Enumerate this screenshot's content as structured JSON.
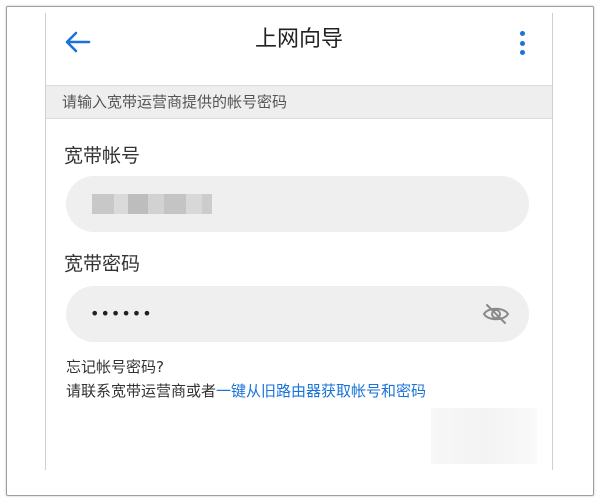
{
  "header": {
    "title": "上网向导",
    "back_icon": "arrow-left-icon",
    "more_icon": "more-vertical-icon"
  },
  "hint": "请输入宽带运营商提供的帐号密码",
  "account": {
    "label": "宽带帐号"
  },
  "password": {
    "label": "宽带密码",
    "value_masked": "••••••",
    "toggle_icon": "eye-off-icon"
  },
  "help": {
    "forgot": "忘记帐号密码?",
    "contact_prefix": "请联系宽带运营商或者",
    "contact_link": "一键从旧路由器获取帐号和密码"
  },
  "colors": {
    "accent": "#1a73d9",
    "field_bg": "#efefef",
    "hint_bg": "#eeeeee"
  }
}
